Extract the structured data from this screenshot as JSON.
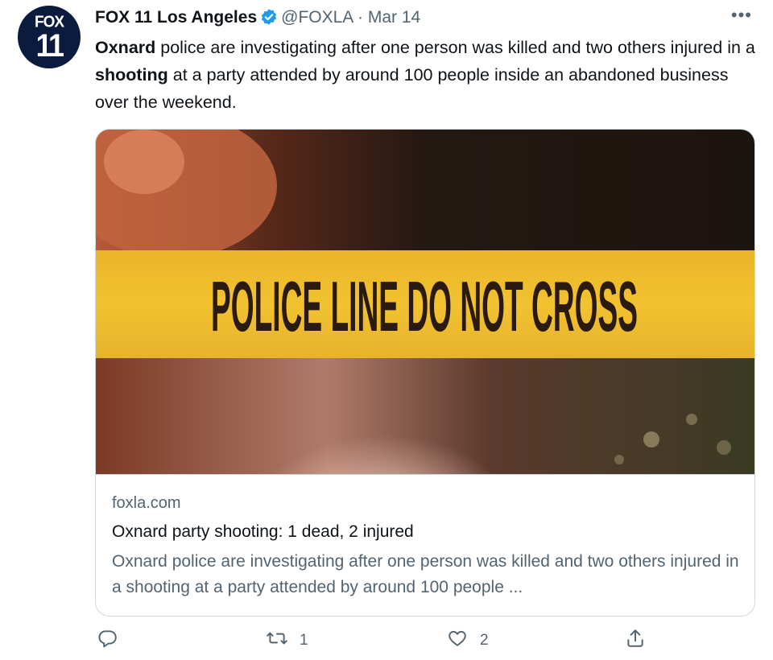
{
  "tweet": {
    "avatar_top": "FOX",
    "avatar_bottom": "11",
    "author_name": "FOX 11 Los Angeles",
    "handle": "@FOXLA",
    "separator": "·",
    "date": "Mar 14",
    "more_label": "•••",
    "text": {
      "p1_bold": "Oxnard",
      "p2": " police are investigating after one person was killed and two others injured in a ",
      "p3_bold": "shooting",
      "p4": " at a party attended by around 100 people inside an abandoned business over the weekend."
    }
  },
  "card": {
    "image_text": "POLICE LINE DO NOT CROSS",
    "domain": "foxla.com",
    "title": "Oxnard party shooting: 1 dead, 2 injured",
    "description": "Oxnard police are investigating after one person was killed and two others injured in a shooting at a party attended by around 100 people ..."
  },
  "actions": {
    "reply_count": "",
    "retweet_count": "1",
    "like_count": "2"
  },
  "colors": {
    "verified_blue": "#1d9bf0",
    "secondary_text": "#536471",
    "tape_yellow": "#f2c230",
    "avatar_navy": "#0a1b3d"
  },
  "icons": [
    "verified-badge-icon",
    "more-icon",
    "reply-icon",
    "retweet-icon",
    "like-icon",
    "share-icon"
  ]
}
